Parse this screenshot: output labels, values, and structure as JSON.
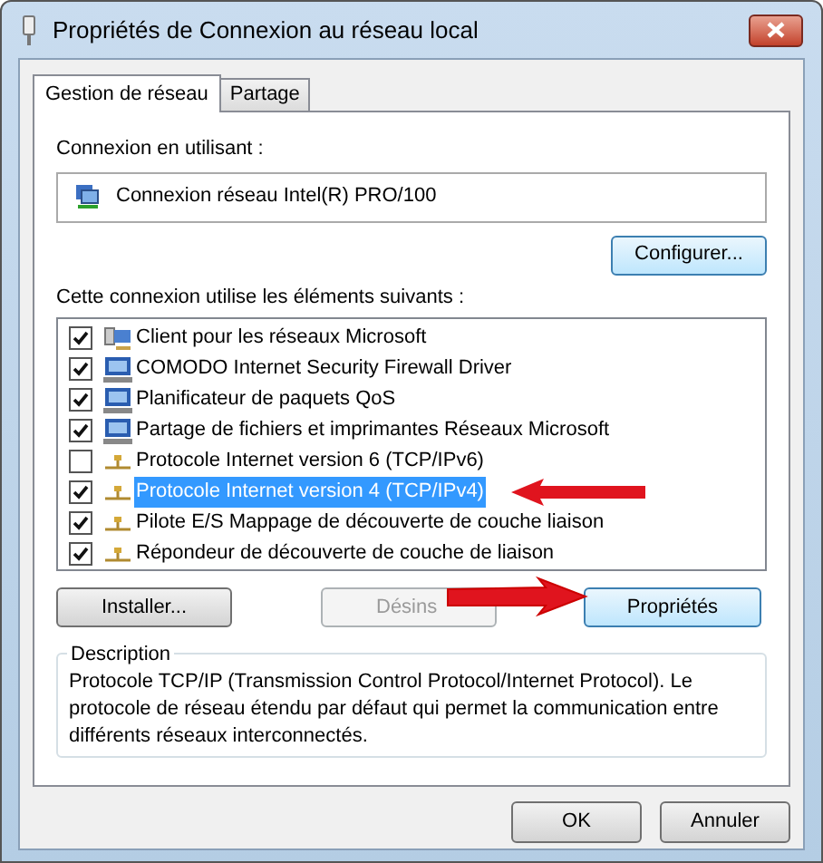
{
  "window": {
    "title": "Propriétés de Connexion au réseau local"
  },
  "tabs": [
    {
      "label": "Gestion de réseau",
      "selected": true
    },
    {
      "label": "Partage",
      "selected": false
    }
  ],
  "adapter": {
    "label": "Connexion en utilisant :",
    "value": "Connexion réseau Intel(R) PRO/100"
  },
  "configure_button": "Configurer...",
  "items_label": "Cette connexion utilise les éléments suivants :",
  "items": [
    {
      "kind": "client",
      "label": "Client pour les réseaux Microsoft",
      "checked": true,
      "selected": false
    },
    {
      "kind": "service",
      "label": "COMODO Internet Security Firewall Driver",
      "checked": true,
      "selected": false
    },
    {
      "kind": "service",
      "label": "Planificateur de paquets QoS",
      "checked": true,
      "selected": false
    },
    {
      "kind": "service",
      "label": "Partage de fichiers et imprimantes Réseaux Microsoft",
      "checked": true,
      "selected": false
    },
    {
      "kind": "protocol",
      "label": "Protocole Internet version 6 (TCP/IPv6)",
      "checked": false,
      "selected": false
    },
    {
      "kind": "protocol",
      "label": "Protocole Internet version 4 (TCP/IPv4)",
      "checked": true,
      "selected": true
    },
    {
      "kind": "protocol",
      "label": "Pilote E/S Mappage de découverte de couche liaison",
      "checked": true,
      "selected": false
    },
    {
      "kind": "protocol",
      "label": "Répondeur de découverte de couche de liaison",
      "checked": true,
      "selected": false
    }
  ],
  "item_buttons": [
    {
      "label": "Installer...",
      "disabled": false
    },
    {
      "label": "Désins",
      "disabled": true
    },
    {
      "label": "Propriétés",
      "disabled": false
    }
  ],
  "description": {
    "title": "Description",
    "text": "Protocole TCP/IP (Transmission Control Protocol/Internet Protocol). Le protocole de réseau étendu par défaut qui permet la communication entre différents réseaux interconnectés."
  },
  "dialog_buttons": [
    "OK",
    "Annuler"
  ]
}
